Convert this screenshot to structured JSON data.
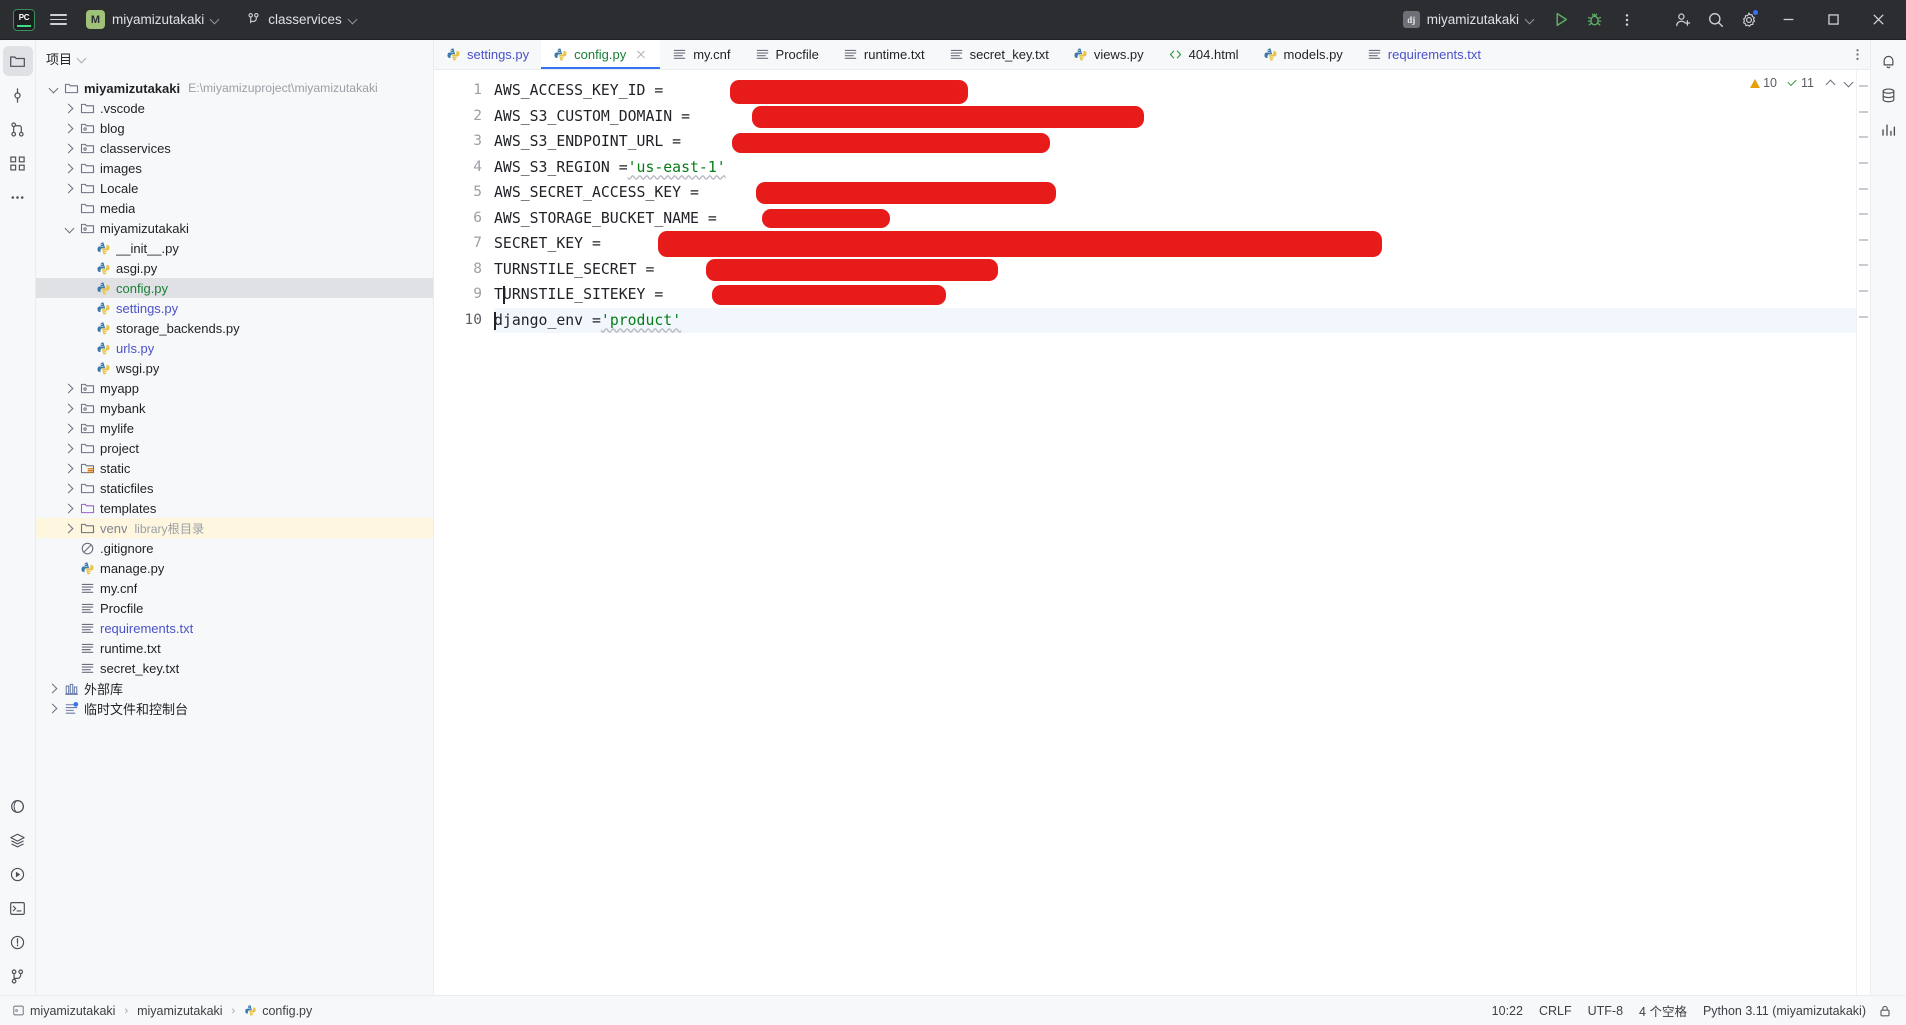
{
  "titlebar": {
    "app_icon": "pycharm-logo-icon",
    "app_initials": "PC",
    "menu_icon": "hamburger-menu-icon",
    "project_badge": "M",
    "project_name": "miyamizutakaki",
    "branch_icon": "git-branch-icon",
    "branch_name": "classervices",
    "run_config_badge": "dj",
    "run_config_name": "miyamizutakaki",
    "run_icon": "run-play-icon",
    "debug_icon": "debug-bug-icon",
    "more_icon": "more-vertical-icon",
    "account_icon": "add-account-icon",
    "search_icon": "search-icon",
    "settings_icon": "gear-icon",
    "minimize_icon": "minimize-icon",
    "maximize_icon": "maximize-icon",
    "close_icon": "close-icon"
  },
  "left_rail": [
    {
      "name": "project-tool-window",
      "icon": "folder-icon",
      "active": true
    },
    {
      "name": "commit-tool-window",
      "icon": "commit-icon",
      "active": false
    },
    {
      "name": "pull-requests-tool-window",
      "icon": "pull-request-icon",
      "active": false
    },
    {
      "name": "structure-tool-window",
      "icon": "structure-icon",
      "active": false
    },
    {
      "name": "more-tool-windows",
      "icon": "more-horizontal-icon",
      "active": false
    }
  ],
  "left_rail_bottom": [
    {
      "name": "python-packages",
      "icon": "python-packages-icon"
    },
    {
      "name": "database-layers",
      "icon": "layers-icon"
    },
    {
      "name": "run-tool-window",
      "icon": "run-circle-icon"
    },
    {
      "name": "terminal-tool-window",
      "icon": "terminal-icon"
    },
    {
      "name": "problems-tool-window",
      "icon": "problems-icon"
    },
    {
      "name": "version-control-tool-window",
      "icon": "vcs-branch-icon"
    }
  ],
  "right_rail": [
    {
      "name": "notifications",
      "icon": "bell-icon"
    },
    {
      "name": "database-tool-window",
      "icon": "database-icon"
    },
    {
      "name": "profiler-tool-window",
      "icon": "chart-bars-icon"
    }
  ],
  "project_panel": {
    "title": "项目",
    "dropdown_icon": "chevron-down-icon",
    "tree": [
      {
        "depth": 0,
        "twist": "open",
        "icon": "folder-icon",
        "label": "miyamizutakaki",
        "bold": true,
        "sub": "E:\\miyamizuproject\\miyamizutakaki"
      },
      {
        "depth": 1,
        "twist": "closed",
        "icon": "folder-icon",
        "label": ".vscode"
      },
      {
        "depth": 1,
        "twist": "closed",
        "icon": "module-folder-icon",
        "label": "blog"
      },
      {
        "depth": 1,
        "twist": "closed",
        "icon": "module-folder-icon",
        "label": "classervices"
      },
      {
        "depth": 1,
        "twist": "closed",
        "icon": "folder-icon",
        "label": "images"
      },
      {
        "depth": 1,
        "twist": "closed",
        "icon": "folder-icon",
        "label": "Locale"
      },
      {
        "depth": 1,
        "twist": "none",
        "icon": "folder-icon",
        "label": "media"
      },
      {
        "depth": 1,
        "twist": "open",
        "icon": "module-folder-icon",
        "label": "miyamizutakaki"
      },
      {
        "depth": 2,
        "twist": "none",
        "icon": "python-file-icon",
        "label": "__init__.py"
      },
      {
        "depth": 2,
        "twist": "none",
        "icon": "python-file-icon",
        "label": "asgi.py"
      },
      {
        "depth": 2,
        "twist": "none",
        "icon": "python-file-icon",
        "label": "config.py",
        "color": "green",
        "selected": true
      },
      {
        "depth": 2,
        "twist": "none",
        "icon": "python-file-icon",
        "label": "settings.py",
        "color": "blue"
      },
      {
        "depth": 2,
        "twist": "none",
        "icon": "python-file-icon",
        "label": "storage_backends.py"
      },
      {
        "depth": 2,
        "twist": "none",
        "icon": "python-file-icon",
        "label": "urls.py",
        "color": "blue"
      },
      {
        "depth": 2,
        "twist": "none",
        "icon": "python-file-icon",
        "label": "wsgi.py"
      },
      {
        "depth": 1,
        "twist": "closed",
        "icon": "module-folder-icon",
        "label": "myapp"
      },
      {
        "depth": 1,
        "twist": "closed",
        "icon": "module-folder-icon",
        "label": "mybank"
      },
      {
        "depth": 1,
        "twist": "closed",
        "icon": "module-folder-icon",
        "label": "mylife"
      },
      {
        "depth": 1,
        "twist": "closed",
        "icon": "folder-icon",
        "label": "project"
      },
      {
        "depth": 1,
        "twist": "closed",
        "icon": "resource-folder-icon",
        "label": "static"
      },
      {
        "depth": 1,
        "twist": "closed",
        "icon": "folder-icon",
        "label": "staticfiles"
      },
      {
        "depth": 1,
        "twist": "closed",
        "icon": "template-folder-icon",
        "label": "templates"
      },
      {
        "depth": 1,
        "twist": "closed",
        "icon": "folder-icon",
        "label": "venv",
        "color": "gray",
        "sub2": "library根目录",
        "highlight": true
      },
      {
        "depth": 1,
        "twist": "none",
        "icon": "gitignore-icon",
        "label": ".gitignore"
      },
      {
        "depth": 1,
        "twist": "none",
        "icon": "python-file-icon",
        "label": "manage.py"
      },
      {
        "depth": 1,
        "twist": "none",
        "icon": "text-file-icon",
        "label": "my.cnf"
      },
      {
        "depth": 1,
        "twist": "none",
        "icon": "text-file-icon",
        "label": "Procfile"
      },
      {
        "depth": 1,
        "twist": "none",
        "icon": "text-file-icon",
        "label": "requirements.txt",
        "color": "blue"
      },
      {
        "depth": 1,
        "twist": "none",
        "icon": "text-file-icon",
        "label": "runtime.txt"
      },
      {
        "depth": 1,
        "twist": "none",
        "icon": "text-file-icon",
        "label": "secret_key.txt"
      },
      {
        "depth": 0,
        "twist": "closed",
        "icon": "external-libs-icon",
        "label": "外部库"
      },
      {
        "depth": 0,
        "twist": "closed",
        "icon": "scratches-icon",
        "label": "临时文件和控制台"
      }
    ]
  },
  "editor": {
    "tabs": [
      {
        "label": "settings.py",
        "icon": "python-file-icon",
        "color": "blue",
        "active": false,
        "closable": false
      },
      {
        "label": "config.py",
        "icon": "python-file-icon",
        "color": "green",
        "active": true,
        "closable": true
      },
      {
        "label": "my.cnf",
        "icon": "text-file-icon",
        "color": "",
        "active": false,
        "closable": false
      },
      {
        "label": "Procfile",
        "icon": "text-file-icon",
        "color": "",
        "active": false,
        "closable": false
      },
      {
        "label": "runtime.txt",
        "icon": "text-file-icon",
        "color": "",
        "active": false,
        "closable": false
      },
      {
        "label": "secret_key.txt",
        "icon": "text-file-icon",
        "color": "",
        "active": false,
        "closable": false
      },
      {
        "label": "views.py",
        "icon": "python-file-icon",
        "color": "",
        "active": false,
        "closable": false
      },
      {
        "label": "404.html",
        "icon": "html-file-icon",
        "color": "",
        "active": false,
        "closable": false
      },
      {
        "label": "models.py",
        "icon": "python-file-icon",
        "color": "",
        "active": false,
        "closable": false
      },
      {
        "label": "requirements.txt",
        "icon": "text-file-icon",
        "color": "blue",
        "active": false,
        "closable": false
      }
    ],
    "tab_options_icon": "more-vertical-icon",
    "inspections": {
      "warning_count": "10",
      "ok_count": "11",
      "warning_icon": "warning-triangle-icon",
      "ok_icon": "check-icon",
      "prev_icon": "chevron-up-icon",
      "next_icon": "chevron-down-icon"
    },
    "lines": [
      {
        "no": "1",
        "name": "AWS_ACCESS_KEY_ID",
        "op": " = ",
        "value": "",
        "redacted": true,
        "current": false
      },
      {
        "no": "2",
        "name": "AWS_S3_CUSTOM_DOMAIN",
        "op": " =",
        "value": "",
        "redacted": true,
        "current": false
      },
      {
        "no": "3",
        "name": "AWS_S3_ENDPOINT_URL",
        "op": " =",
        "value": "",
        "redacted": true,
        "current": false
      },
      {
        "no": "4",
        "name": "AWS_S3_REGION",
        "op": " =",
        "value": "'us-east-1'",
        "redacted": false,
        "current": false
      },
      {
        "no": "5",
        "name": "AWS_SECRET_ACCESS_KEY",
        "op": " =",
        "value": "",
        "redacted": true,
        "current": false
      },
      {
        "no": "6",
        "name": "AWS_STORAGE_BUCKET_NAME",
        "op": " = ",
        "value": "",
        "redacted": true,
        "current": false
      },
      {
        "no": "7",
        "name": "SECRET_KEY",
        "op": " =",
        "value": "",
        "redacted": true,
        "current": false
      },
      {
        "no": "8",
        "name": "TURNSTILE_SECRET",
        "op": " =",
        "value": "",
        "redacted": true,
        "current": false
      },
      {
        "no": "9",
        "name": "TURNSTILE_SITEKEY",
        "op": " =",
        "value": "",
        "redacted": true,
        "current": false
      },
      {
        "no": "10",
        "name": "django_env",
        "op": " =",
        "value": "'product'",
        "redacted": false,
        "current": true
      }
    ]
  },
  "statusbar": {
    "breadcrumbs": [
      {
        "label": "miyamizutakaki",
        "icon": "project-box-icon"
      },
      {
        "label": "miyamizutakaki",
        "icon": ""
      },
      {
        "label": "config.py",
        "icon": "python-file-icon"
      }
    ],
    "cursor_position": "10:22",
    "line_separator": "CRLF",
    "encoding": "UTF-8",
    "indent": "4 个空格",
    "interpreter": "Python 3.11 (miyamizutakaki)",
    "lock_icon": "lock-icon"
  },
  "colors": {
    "accent": "#3574f0",
    "titlebar_bg": "#2b2d30",
    "panel_bg": "#f7f8fa",
    "editor_bg": "#ffffff",
    "string_green": "#067d17",
    "vcs_added_green": "#1a7f37",
    "vcs_modified_blue": "#4a52c8",
    "redaction_red": "#e81b1b",
    "selection_gray": "#dfe1e5",
    "highlight_yellow": "#fff6df"
  }
}
